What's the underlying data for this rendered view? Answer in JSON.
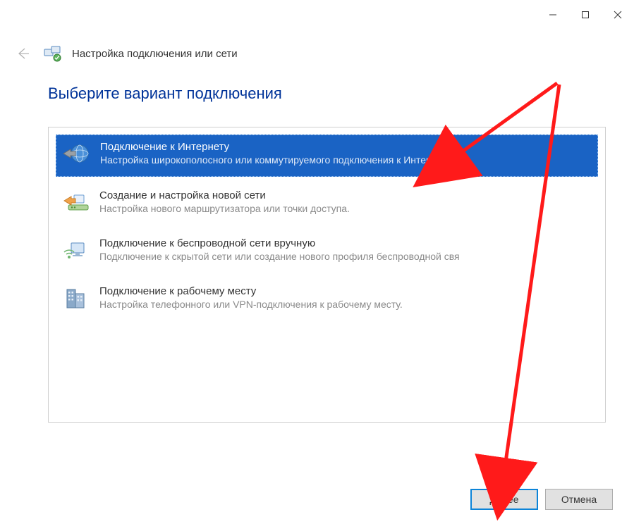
{
  "window": {
    "title": "Настройка подключения или сети"
  },
  "page": {
    "heading": "Выберите вариант подключения"
  },
  "options": [
    {
      "title": "Подключение к Интернету",
      "desc": "Настройка широкополосного или коммутируемого подключения к Интернету.",
      "selected": true
    },
    {
      "title": "Создание и настройка новой сети",
      "desc": "Настройка нового маршрутизатора или точки доступа.",
      "selected": false
    },
    {
      "title": "Подключение к беспроводной сети вручную",
      "desc": "Подключение к скрытой сети или создание нового профиля беспроводной свя",
      "selected": false
    },
    {
      "title": "Подключение к рабочему месту",
      "desc": "Настройка телефонного или VPN-подключения к рабочему месту.",
      "selected": false
    }
  ],
  "buttons": {
    "next": "Далее",
    "cancel": "Отмена"
  }
}
